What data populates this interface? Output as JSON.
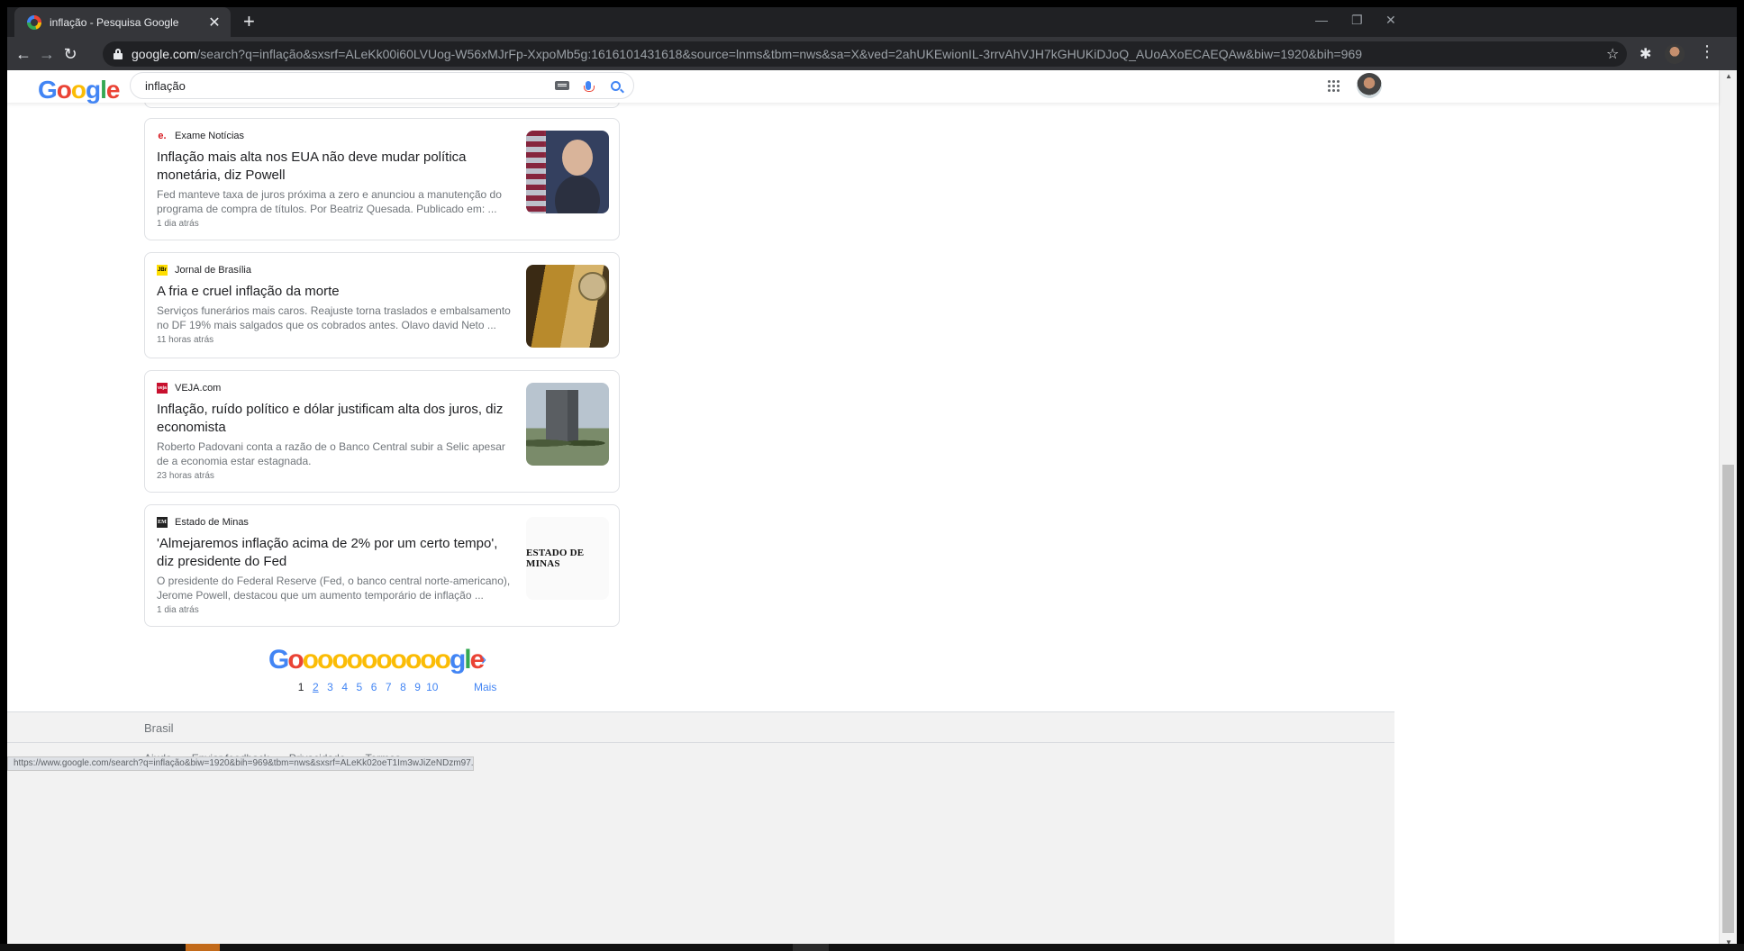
{
  "browser": {
    "tab_title": "inflação - Pesquisa Google",
    "tab_close": "✕",
    "new_tab": "+",
    "url_host": "google.com",
    "url_path": "/search?q=inflação&sxsrf=ALeKk00i60LVUog-W56xMJrFp-XxpoMb5g:1616101431618&source=lnms&tbm=nws&sa=X&ved=2ahUKEwionIL-3rrvAhVJH7kGHUKiDJoQ_AUoAXoECAEQAw&biw=1920&bih=969",
    "controls": {
      "minimize": "—",
      "restore": "❐",
      "close": "✕"
    },
    "nav": {
      "back": "←",
      "forward": "→",
      "reload": "↻"
    },
    "star": "☆",
    "extensions": "✱",
    "menu": "⋮"
  },
  "search": {
    "logo_letters": [
      "G",
      "o",
      "o",
      "g",
      "l",
      "e"
    ],
    "query": "inflação"
  },
  "results": [
    {
      "source": "Exame Notícias",
      "source_icon": "e.",
      "title": "Inflação mais alta nos EUA não deve mudar política monetária, diz Powell",
      "snippet": "Fed manteve taxa de juros próxima a zero e anunciou a manutenção do programa de compra de títulos. Por Beatriz Quesada. Publicado em: ...",
      "time": "1 dia atrás"
    },
    {
      "source": "Jornal de Brasília",
      "source_icon": "JBr",
      "title": "A fria e cruel inflação da morte",
      "snippet": "Serviços funerários mais caros. Reajuste torna traslados e embalsamento no DF 19% mais salgados que os cobrados antes. Olavo david Neto ...",
      "time": "11 horas atrás"
    },
    {
      "source": "VEJA.com",
      "source_icon": "veja",
      "title": "Inflação, ruído político e dólar justificam alta dos juros, diz economista",
      "snippet": "Roberto Padovani conta a razão de o Banco Central subir a Selic apesar de a economia estar estagnada.",
      "time": "23 horas atrás"
    },
    {
      "source": "Estado de Minas",
      "source_icon": "EM",
      "title": "'Almejaremos inflação acima de 2% por um certo tempo', diz presidente do Fed",
      "snippet": "O presidente do Federal Reserve (Fed, o banco central norte-americano), Jerome Powell, destacou que um aumento temporário de inflação ...",
      "time": "1 dia atrás",
      "thumb_text": "ESTADO DE MINAS"
    }
  ],
  "pagination": {
    "logo": "Gooooooooooogle",
    "pages": [
      "1",
      "2",
      "3",
      "4",
      "5",
      "6",
      "7",
      "8",
      "9",
      "10"
    ],
    "next_arrow": "›",
    "more": "Mais"
  },
  "footer": {
    "country": "Brasil",
    "links": [
      "Ajuda",
      "Enviar feedback",
      "Privacidade",
      "Termos"
    ]
  },
  "status_url": "https://www.google.com/search?q=inflação&biw=1920&bih=969&tbm=nws&sxsrf=ALeKk02oeT1Im3wJiZeNDzm97...",
  "colors": {
    "google_blue": "#4285f4",
    "google_red": "#ea4335",
    "google_yellow": "#fbbc05",
    "google_green": "#34a853",
    "chrome_dark": "#202124"
  }
}
